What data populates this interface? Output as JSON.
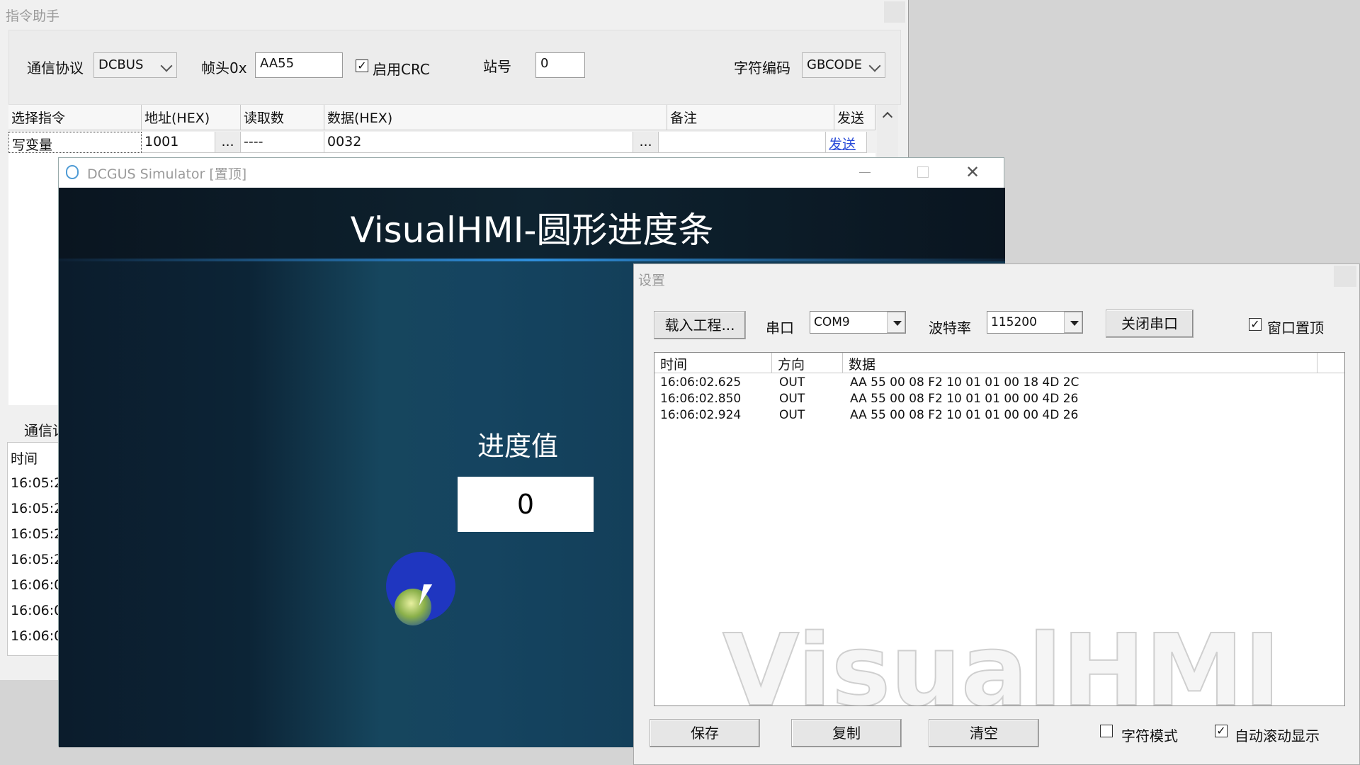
{
  "assistant": {
    "title": "指令助手",
    "protocol_label": "通信协议",
    "protocol_value": "DCBUS",
    "frame_label": "帧头0x",
    "frame_value": "AA55",
    "crc_label": "启用CRC",
    "crc_checked": "✓",
    "station_label": "站号",
    "station_value": "0",
    "encoding_label": "字符编码",
    "encoding_value": "GBCODE",
    "columns": [
      "选择指令",
      "地址(HEX)",
      "读取数",
      "数据(HEX)",
      "备注",
      "发送"
    ],
    "row": {
      "cmd": "写变量",
      "addr": "1001",
      "addr_btn": "...",
      "count": "----",
      "data": "0032",
      "data_btn": "...",
      "note": "",
      "send": "发送"
    },
    "comm_label": "通信记",
    "log_header": "时间",
    "log_times": [
      "16:05:2",
      "16:05:2",
      "16:05:2",
      "16:05:2",
      "16:06:0",
      "16:06:0",
      "16:06:0"
    ]
  },
  "simulator": {
    "title": "DCGUS Simulator [置顶]",
    "heading": "VisualHMI-圆形进度条",
    "progress_label": "进度值",
    "progress_value": "0"
  },
  "settings": {
    "title": "设置",
    "load_button": "载入工程...",
    "port_label": "串口",
    "port_value": "COM9",
    "baud_label": "波特率",
    "baud_value": "115200",
    "close_port_button": "关闭串口",
    "topmost_label": "窗口置顶",
    "topmost_checked": "✓",
    "log_columns": [
      "时间",
      "方向",
      "数据"
    ],
    "log_rows": [
      {
        "time": "16:06:02.625",
        "dir": "OUT",
        "data": "AA 55 00 08 F2 10 01 01 00 18 4D 2C"
      },
      {
        "time": "16:06:02.850",
        "dir": "OUT",
        "data": "AA 55 00 08 F2 10 01 01 00 00 4D 26"
      },
      {
        "time": "16:06:02.924",
        "dir": "OUT",
        "data": "AA 55 00 08 F2 10 01 01 00 00 4D 26"
      }
    ],
    "watermark": "VisualHMI",
    "save_button": "保存",
    "copy_button": "复制",
    "clear_button": "清空",
    "char_mode_label": "字符模式",
    "auto_scroll_label": "自动滚动显示",
    "auto_scroll_checked": "✓"
  }
}
